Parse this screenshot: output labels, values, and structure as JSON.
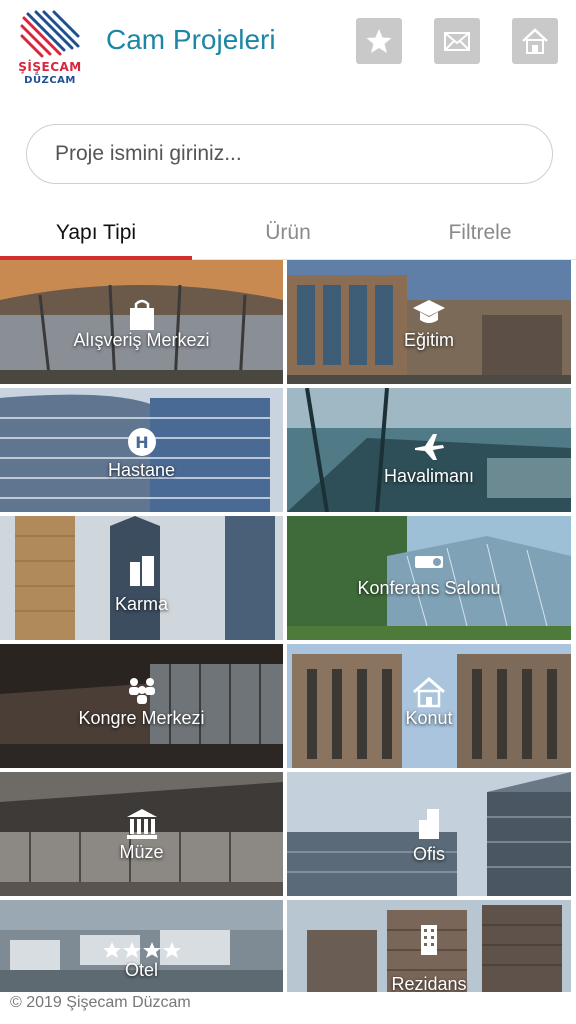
{
  "header": {
    "logo_line1": "ŞİŞECAM",
    "logo_line2": "DÜZCAM",
    "title": "Cam Projeleri",
    "buttons": [
      {
        "icon": "star-icon"
      },
      {
        "icon": "mail-icon"
      },
      {
        "icon": "home-icon"
      }
    ]
  },
  "search": {
    "placeholder": "Proje ismini giriniz..."
  },
  "tabs": [
    {
      "label": "Yapı Tipi",
      "active": true
    },
    {
      "label": "Ürün",
      "active": false
    },
    {
      "label": "Filtrele",
      "active": false
    }
  ],
  "categories": [
    {
      "label": "Alışveriş Merkezi",
      "icon": "shopping-bag-icon"
    },
    {
      "label": "Eğitim",
      "icon": "graduation-cap-icon"
    },
    {
      "label": "Hastane",
      "icon": "hospital-icon"
    },
    {
      "label": "Havalimanı",
      "icon": "airplane-icon"
    },
    {
      "label": "Karma",
      "icon": "buildings-icon"
    },
    {
      "label": "Konferans Salonu",
      "icon": "projector-icon"
    },
    {
      "label": "Kongre Merkezi",
      "icon": "people-icon"
    },
    {
      "label": "Konut",
      "icon": "house-icon"
    },
    {
      "label": "Müze",
      "icon": "museum-icon"
    },
    {
      "label": "Ofis",
      "icon": "office-icon"
    },
    {
      "label": "Otel",
      "icon": "stars-icon"
    },
    {
      "label": "Rezidans",
      "icon": "tower-icon"
    }
  ],
  "colors": {
    "accent": "#d32f2f",
    "title": "#1c86a6",
    "header_button": "#c9c9c9"
  },
  "footer": {
    "copyright": "© 2019 Şişecam Düzcam"
  }
}
